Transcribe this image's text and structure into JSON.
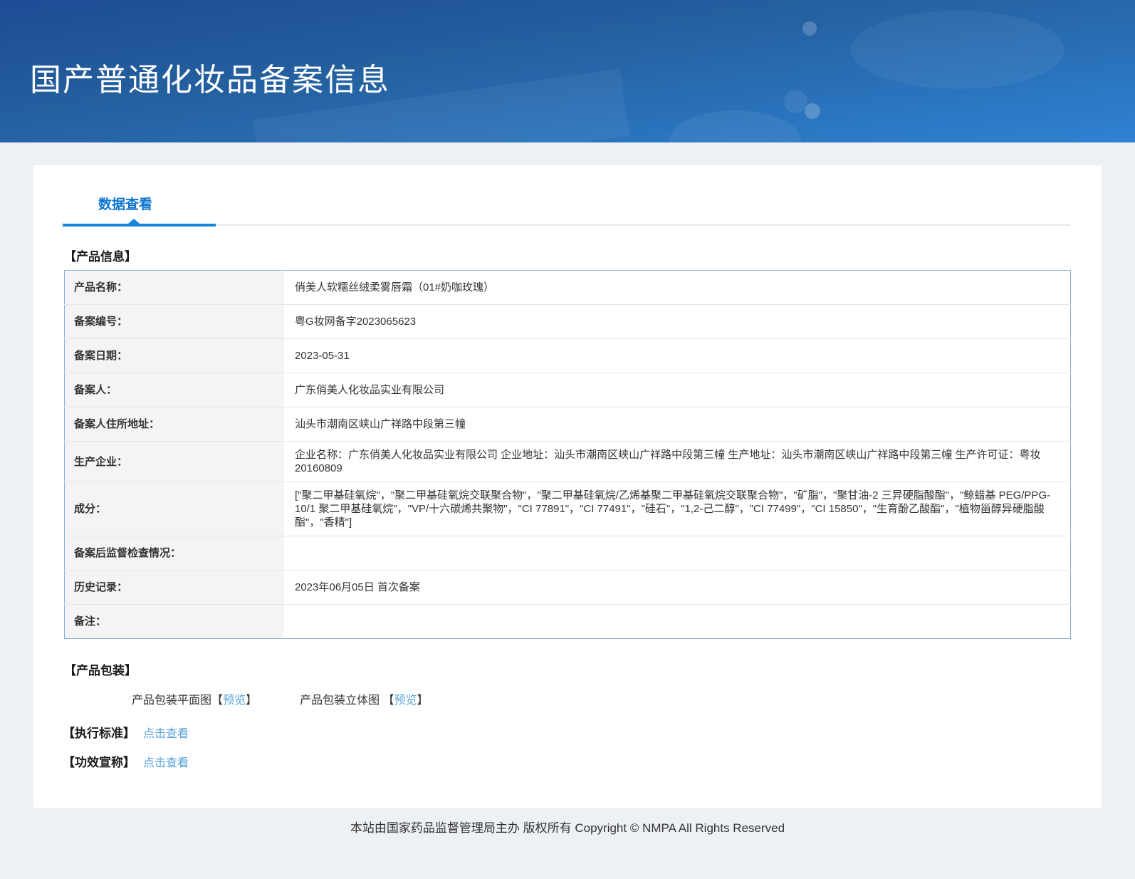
{
  "header": {
    "title": "国产普通化妆品备案信息"
  },
  "tabs": {
    "active": "数据查看"
  },
  "product_info": {
    "heading": "【产品信息】",
    "rows": [
      {
        "label": "产品名称：",
        "value": "俏美人软糯丝绒柔雾唇霜（01#奶咖玫瑰）"
      },
      {
        "label": "备案编号：",
        "value": "粤G妆网备字2023065623"
      },
      {
        "label": "备案日期：",
        "value": "2023-05-31"
      },
      {
        "label": "备案人：",
        "value": "广东俏美人化妆品实业有限公司"
      },
      {
        "label": "备案人住所地址：",
        "value": "汕头市潮南区峡山广祥路中段第三幢"
      },
      {
        "label": "生产企业：",
        "value": "企业名称：广东俏美人化妆品实业有限公司 企业地址：汕头市潮南区峡山广祥路中段第三幢 生产地址：汕头市潮南区峡山广祥路中段第三幢 生产许可证：粤妆20160809"
      },
      {
        "label": "成分：",
        "value": "[\"聚二甲基硅氧烷\"，\"聚二甲基硅氧烷交联聚合物\"，\"聚二甲基硅氧烷/乙烯基聚二甲基硅氧烷交联聚合物\"，\"矿脂\"，\"聚甘油-2 三异硬脂酸酯\"，\"鲸蜡基 PEG/PPG-10/1 聚二甲基硅氧烷\"，\"VP/十六碳烯共聚物\"，\"CI 77891\"，\"CI 77491\"，\"硅石\"，\"1,2-己二醇\"，\"CI 77499\"，\"CI 15850\"，\"生育酚乙酸酯\"，\"植物甾醇异硬脂酸酯\"，\"香精\"]"
      },
      {
        "label": "备案后监督检查情况：",
        "value": ""
      },
      {
        "label": "历史记录：",
        "value": "2023年06月05日 首次备案"
      },
      {
        "label": "备注：",
        "value": ""
      }
    ]
  },
  "packaging": {
    "heading": "【产品包装】",
    "items": [
      {
        "label": "产品包装平面图",
        "bracket_open": "【",
        "link": "预览",
        "bracket_close": "】"
      },
      {
        "label": "产品包装立体图 ",
        "bracket_open": "【",
        "link": "预览",
        "bracket_close": "】"
      }
    ]
  },
  "standard": {
    "label": "【执行标准】",
    "link": "点击查看"
  },
  "efficacy": {
    "label": "【功效宣称】",
    "link": "点击查看"
  },
  "footer": {
    "text": "本站由国家药品监督管理局主办 版权所有 Copyright © NMPA All Rights Reserved"
  },
  "colors": {
    "header_gradient_top": "#1d4c94",
    "header_gradient_bottom": "#2f82d3",
    "accent_blue": "#0c76d0",
    "tab_underline_blue": "#1786da",
    "link_blue": "#55a0d8",
    "table_border_blue": "#85b1de",
    "label_cell_bg": "#f4f4f4",
    "page_bg": "#eef1f4"
  }
}
